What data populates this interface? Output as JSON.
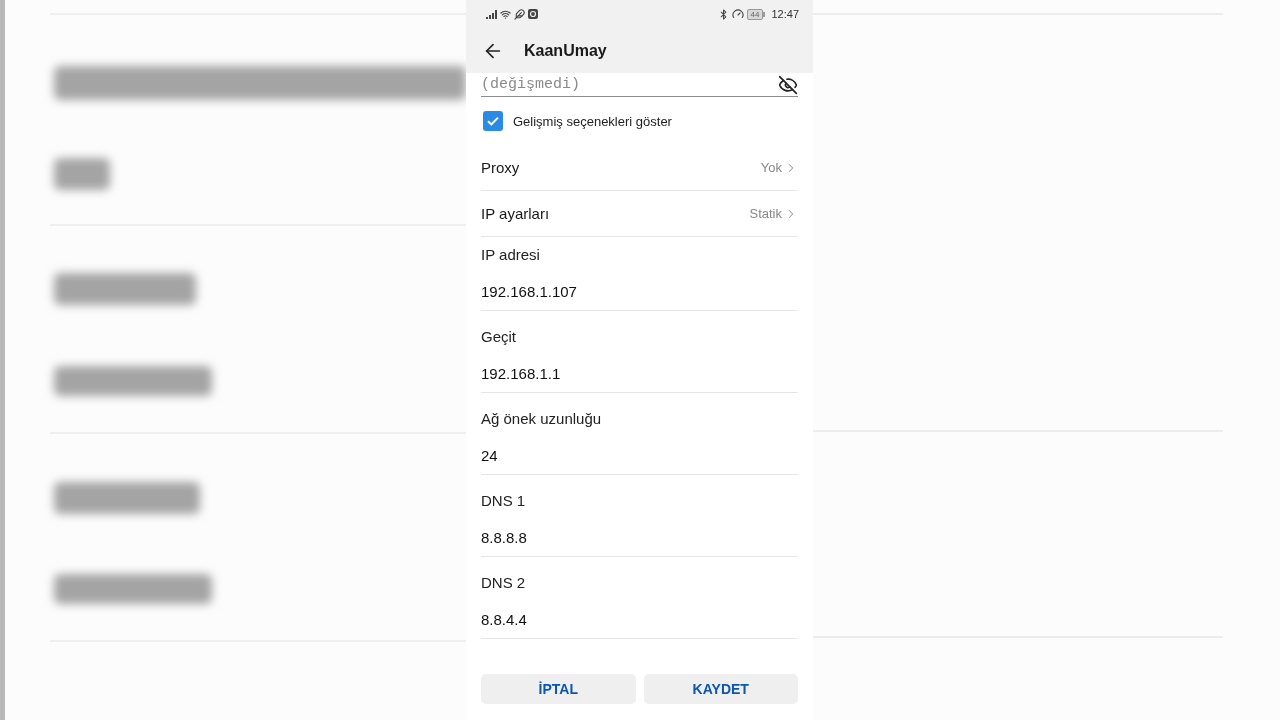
{
  "status_bar": {
    "battery": "44",
    "time": "12:47"
  },
  "header": {
    "title": "KaanUmay"
  },
  "password_field": {
    "placeholder": "(değişmedi)"
  },
  "show_advanced": {
    "label": "Gelişmiş seçenekleri göster",
    "checked": true
  },
  "settings": [
    {
      "label": "Proxy",
      "value": "Yok"
    },
    {
      "label": "IP ayarları",
      "value": "Statik"
    }
  ],
  "fields": [
    {
      "label": "IP adresi",
      "value": "192.168.1.107"
    },
    {
      "label": "Geçit",
      "value": "192.168.1.1"
    },
    {
      "label": "Ağ önek uzunluğu",
      "value": "24"
    },
    {
      "label": "DNS 1",
      "value": "8.8.8.8"
    },
    {
      "label": "DNS 2",
      "value": "8.8.4.4"
    }
  ],
  "buttons": [
    {
      "label": "İPTAL"
    },
    {
      "label": "KAYDET"
    }
  ]
}
